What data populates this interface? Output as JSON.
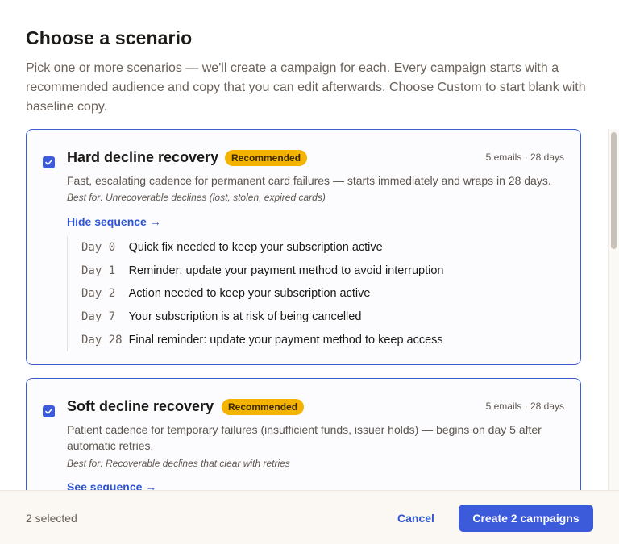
{
  "modal": {
    "title": "Choose a scenario",
    "subtitle": "Pick one or more scenarios — we'll create a campaign for each. Every campaign starts with a recommended audience and copy that you can edit afterwards. Choose Custom to start blank with baseline copy."
  },
  "scenarios": [
    {
      "checked": true,
      "title": "Hard decline recovery",
      "badge": "Recommended",
      "meta": "5 emails · 28 days",
      "description": "Fast, escalating cadence for permanent card failures — starts immediately and wraps in 28 days.",
      "best_for": "Best for: Unrecoverable declines (lost, stolen, expired cards)",
      "sequence_link": "Hide sequence →",
      "sequence": [
        {
          "day": "Day 0 ",
          "subject": "Quick fix needed to keep your subscription active"
        },
        {
          "day": "Day 1 ",
          "subject": "Reminder: update your payment method to avoid interruption"
        },
        {
          "day": "Day 2 ",
          "subject": "Action needed to keep your subscription active"
        },
        {
          "day": "Day 7 ",
          "subject": "Your subscription is at risk of being cancelled"
        },
        {
          "day": "Day 28",
          "subject": "Final reminder: update your payment method to keep access"
        }
      ]
    },
    {
      "checked": true,
      "title": "Soft decline recovery",
      "badge": "Recommended",
      "meta": "5 emails · 28 days",
      "description": "Patient cadence for temporary failures (insufficient funds, issuer holds) — begins on day 5 after automatic retries.",
      "best_for": "Best for: Recoverable declines that clear with retries",
      "sequence_link": "See sequence →"
    }
  ],
  "footer": {
    "selected_text": "2 selected",
    "cancel_label": "Cancel",
    "create_label": "Create 2 campaigns"
  },
  "colors": {
    "accent": "#3b5bdb",
    "badge": "#f5b301",
    "card_border": "#3f5fcf"
  },
  "icons": {
    "checkbox": "check-icon"
  }
}
